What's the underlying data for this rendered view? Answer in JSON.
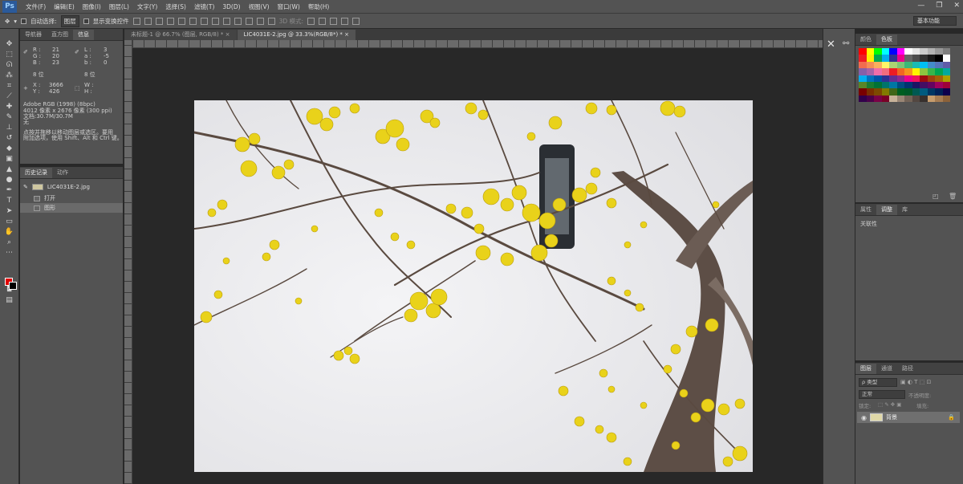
{
  "menu": {
    "logo": "Ps",
    "items": [
      "文件(F)",
      "编辑(E)",
      "图像(I)",
      "图层(L)",
      "文字(Y)",
      "选择(S)",
      "滤镜(T)",
      "3D(D)",
      "视图(V)",
      "窗口(W)",
      "帮助(H)"
    ],
    "window_controls": [
      "—",
      "❐",
      "✕"
    ]
  },
  "options": {
    "auto_select": "自动选择:",
    "auto_select_value": "图层",
    "show_transform": "显示变换控件",
    "mode_3d": "3D 模式:",
    "workspace": "基本功能"
  },
  "tabs": {
    "doc1": "未标题-1 @ 66.7% (图层, RGB/8) *  ×",
    "doc2": "LIC4031E-2.jpg @ 33.3%(RGB/8*) *  ×"
  },
  "info_panel": {
    "tabs": [
      "导航器",
      "直方图",
      "信息"
    ],
    "r_label": "R :",
    "r_value": "21",
    "g_label": "G :",
    "g_value": "20",
    "b_label": "B :",
    "b_value": "23",
    "l_label": "L :",
    "l_value": "3",
    "a_label": "a :",
    "a_value": "-5",
    "bb_label": "b :",
    "bb_value": "0",
    "bit_left": "8 位",
    "bit_right": "8 位",
    "x_label": "X :",
    "x_value": "3666",
    "y_label": "Y :",
    "y_value": "426",
    "w_label": "W :",
    "h_label": "H :",
    "profile": "Adobe RGB (1998) (8bpc)",
    "size": "4012 像素 x 2676 像素 (300 ppi)",
    "doc_size": "文档:30.7M/30.7M",
    "blank": "无",
    "hint1": "点按并拖移以移动图层或选区。要用",
    "hint2": "附加选项，使用 Shift、Alt 和 Ctrl 键。"
  },
  "history_panel": {
    "tabs": [
      "历史记录",
      "动作"
    ],
    "snapshot": "LIC4031E-2.jpg",
    "open": "打开",
    "step": "图形"
  },
  "right_panels": {
    "swatch_tabs": [
      "颜色",
      "色板"
    ],
    "lib_tabs": [
      "属性",
      "调整",
      "库"
    ],
    "lib_content": "关联性",
    "layers_tabs": [
      "图层",
      "通道",
      "路径"
    ],
    "kind_label": "ρ 类型",
    "blend_mode": "正常",
    "opacity_label": "不透明度:",
    "lock_label": "锁定:",
    "fill_label": "填充:",
    "layer_name": "背景"
  },
  "swatches": [
    "#ff0000",
    "#ffff00",
    "#00ff00",
    "#00ffff",
    "#0000ff",
    "#ff00ff",
    "#ffffff",
    "#e6e6e6",
    "#cccccc",
    "#b3b3b3",
    "#999999",
    "#808080",
    "#ed1c24",
    "#fff200",
    "#00a651",
    "#00aeef",
    "#2e3192",
    "#ec008c",
    "#666666",
    "#4d4d4d",
    "#333333",
    "#1a1a1a",
    "#000000",
    "#ffffff",
    "#f26c4f",
    "#f68e56",
    "#fbaf5d",
    "#fff568",
    "#acd372",
    "#7cc576",
    "#3bb878",
    "#1abbb4",
    "#00bff3",
    "#438cca",
    "#5574b9",
    "#605ca8",
    "#8560a8",
    "#a763a8",
    "#f06ea9",
    "#f26d7d",
    "#ed1c24",
    "#f26522",
    "#f7941d",
    "#fff200",
    "#8dc63f",
    "#39b54a",
    "#00a651",
    "#00a99d",
    "#00aeef",
    "#0072bc",
    "#0054a6",
    "#2e3192",
    "#662d91",
    "#92278f",
    "#ec008c",
    "#ed145b",
    "#9e0b0f",
    "#a0410d",
    "#a36209",
    "#aba000",
    "#598527",
    "#1a7b30",
    "#007236",
    "#00746b",
    "#0076a3",
    "#004b80",
    "#003471",
    "#1b1464",
    "#440e62",
    "#630460",
    "#9e005d",
    "#9e0039",
    "#790000",
    "#7b2e00",
    "#7d4900",
    "#827b00",
    "#406618",
    "#005e20",
    "#005826",
    "#005952",
    "#005b7f",
    "#003663",
    "#002157",
    "#0d004c",
    "#32004b",
    "#4b0049",
    "#7b0046",
    "#7a0026",
    "#c7b299",
    "#998675",
    "#736357",
    "#534741",
    "#37302d",
    "#c69c6d",
    "#a67c52",
    "#8c6239"
  ]
}
